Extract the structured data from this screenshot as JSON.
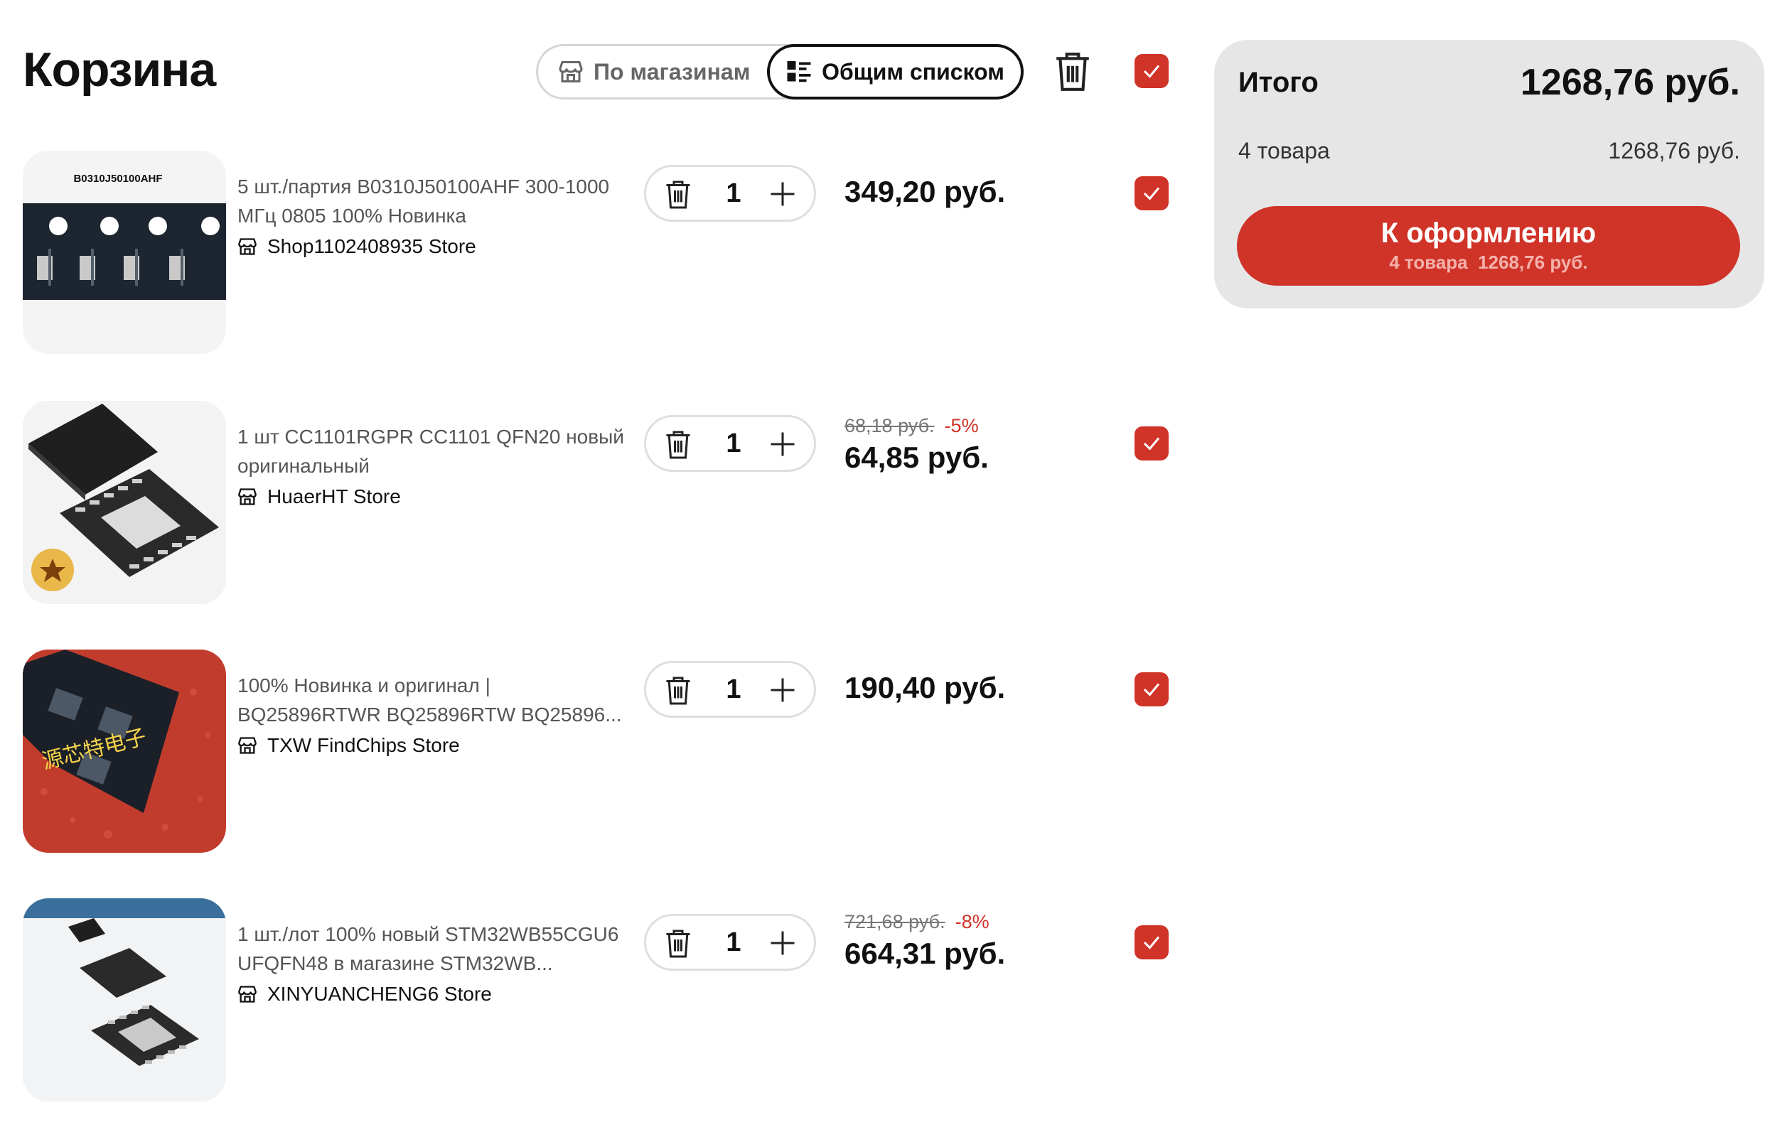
{
  "header": {
    "title": "Корзина",
    "view_toggle": {
      "by_shops": "По магазинам",
      "common_list": "Общим списком",
      "selected": "common_list"
    }
  },
  "colors": {
    "accent": "#d03328",
    "summary_bg": "#e6e6e6"
  },
  "items": [
    {
      "image_label": "B0310J50100AHF",
      "name": "5 шт./партия B0310J50100AHF 300-1000 МГц 0805 100% Новинка",
      "store": "Shop1102408935 Store",
      "qty": "1",
      "price": "349,20 руб.",
      "checked": true
    },
    {
      "name": "1 шт CC1101RGPR CC1101 QFN20 новый оригинальный",
      "store": "HuaerHT Store",
      "qty": "1",
      "old_price": "68,18 руб.",
      "discount": "-5%",
      "price": "64,85 руб.",
      "checked": true
    },
    {
      "image_label": "源芯特电子",
      "name": "100% Новинка и оригинал | BQ25896RTWR BQ25896RTW BQ25896...",
      "store": "TXW FindChips Store",
      "qty": "1",
      "price": "190,40 руб.",
      "checked": true
    },
    {
      "name": "1 шт./лот 100% новый STM32WB55CGU6 UFQFN48 в магазине STM32WB...",
      "store": "XINYUANCHENG6 Store",
      "qty": "1",
      "old_price": "721,68 руб.",
      "discount": "-8%",
      "price": "664,31 руб.",
      "checked": true
    }
  ],
  "summary": {
    "label": "Итого",
    "total": "1268,76 руб.",
    "count": "4 товара",
    "subtotal": "1268,76 руб.",
    "checkout_label": "К оформлению",
    "checkout_count": "4 товара",
    "checkout_total": "1268,76 руб."
  }
}
